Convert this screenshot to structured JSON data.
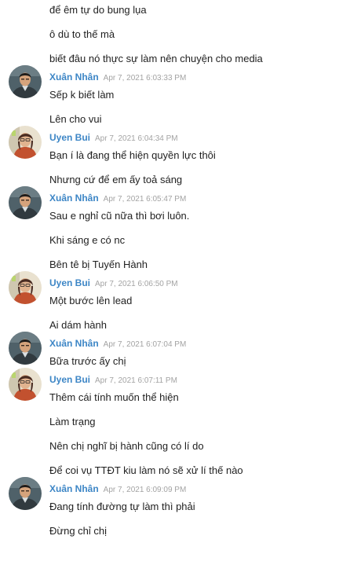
{
  "messages": [
    {
      "type": "text",
      "text": "để êm tự do bung lụa"
    },
    {
      "type": "text",
      "text": "ô dù to thế mà"
    },
    {
      "type": "text",
      "text": "biết đâu nó thực sự làm nên chuyện cho media"
    },
    {
      "type": "header",
      "author": "Xuân Nhân",
      "time": "Apr 7, 2021 6:03:33 PM",
      "avatar": "avatar-xuan-nhan"
    },
    {
      "type": "text",
      "text": "Sếp k biết làm"
    },
    {
      "type": "text",
      "text": "Lên cho vui"
    },
    {
      "type": "header",
      "author": "Uyen Bui",
      "time": "Apr 7, 2021 6:04:34 PM",
      "avatar": "avatar-uyen-bui"
    },
    {
      "type": "text",
      "text": "Bạn í là đang thể hiện quyền lực thôi"
    },
    {
      "type": "text",
      "text": "Nhưng cứ để em ấy toả sáng"
    },
    {
      "type": "header",
      "author": "Xuân Nhân",
      "time": "Apr 7, 2021 6:05:47 PM",
      "avatar": "avatar-xuan-nhan"
    },
    {
      "type": "text",
      "text": "Sau e nghỉ cũ nữa thì bơi luôn."
    },
    {
      "type": "text",
      "text": "Khi sáng e có nc"
    },
    {
      "type": "text",
      "text": "Bên tê bị Tuyến Hành"
    },
    {
      "type": "header",
      "author": "Uyen Bui",
      "time": "Apr 7, 2021 6:06:50 PM",
      "avatar": "avatar-uyen-bui"
    },
    {
      "type": "text",
      "text": "Một bước lên lead"
    },
    {
      "type": "text",
      "text": "Ai dám hành"
    },
    {
      "type": "header",
      "author": "Xuân Nhân",
      "time": "Apr 7, 2021 6:07:04 PM",
      "avatar": "avatar-xuan-nhan"
    },
    {
      "type": "text",
      "text": "Bữa trước ấy chị"
    },
    {
      "type": "header",
      "author": "Uyen Bui",
      "time": "Apr 7, 2021 6:07:11 PM",
      "avatar": "avatar-uyen-bui"
    },
    {
      "type": "text",
      "text": "Thêm cái tính muốn thể hiện"
    },
    {
      "type": "text",
      "text": "Làm trạng"
    },
    {
      "type": "text",
      "text": "Nên chị nghĩ bị hành cũng có lí do"
    },
    {
      "type": "text",
      "text": "Để coi vụ TTĐT kiu làm nó sẽ xử lí thế nào"
    },
    {
      "type": "header",
      "author": "Xuân Nhân",
      "time": "Apr 7, 2021 6:09:09 PM",
      "avatar": "avatar-xuan-nhan"
    },
    {
      "type": "text",
      "text": "Đang tính đường tự làm thì phải"
    },
    {
      "type": "text",
      "text": "Đừng chỉ chị"
    }
  ],
  "colors": {
    "author": "#3d86c6",
    "timestamp": "#a3a3a3",
    "text": "#1f1f1f",
    "background": "#ffffff"
  }
}
